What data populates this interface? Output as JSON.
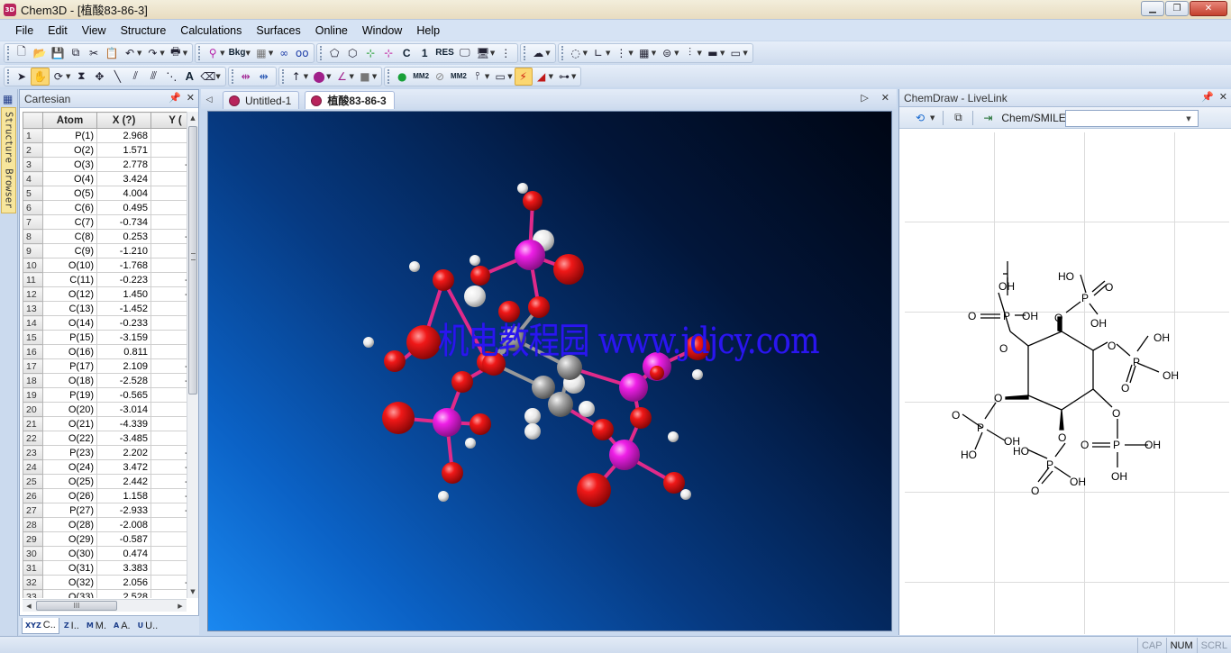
{
  "window": {
    "title": "Chem3D - [植酸83-86-3]",
    "app_icon": "3D"
  },
  "menu": [
    "File",
    "Edit",
    "View",
    "Structure",
    "Calculations",
    "Surfaces",
    "Online",
    "Window",
    "Help"
  ],
  "toolbar": {
    "bkg_label": "Bkg",
    "c_label": "C",
    "one_label": "1",
    "res_label": "RES",
    "mm2_label": "MM2",
    "mm2b_label": "MM2",
    "text_tool_label": "A"
  },
  "structure_browser": {
    "label": "Structure Browser"
  },
  "cartesian": {
    "title": "Cartesian",
    "columns": [
      "Atom",
      "X (?)",
      "Y ("
    ],
    "rows": [
      [
        "1",
        "P(1)",
        "2.968",
        "0."
      ],
      [
        "2",
        "O(2)",
        "1.571",
        "0."
      ],
      [
        "3",
        "O(3)",
        "2.778",
        "-1."
      ],
      [
        "4",
        "O(4)",
        "3.424",
        "0."
      ],
      [
        "5",
        "O(5)",
        "4.004",
        "0."
      ],
      [
        "6",
        "C(6)",
        "0.495",
        "0."
      ],
      [
        "7",
        "C(7)",
        "-0.734",
        "0."
      ],
      [
        "8",
        "C(8)",
        "0.253",
        "-0."
      ],
      [
        "9",
        "C(9)",
        "-1.210",
        "1."
      ],
      [
        "10",
        "O(10)",
        "-1.768",
        "0."
      ],
      [
        "11",
        "C(11)",
        "-0.223",
        "-0."
      ],
      [
        "12",
        "O(12)",
        "1.450",
        "-1."
      ],
      [
        "13",
        "C(13)",
        "-1.452",
        "0."
      ],
      [
        "14",
        "O(14)",
        "-0.233",
        "2."
      ],
      [
        "15",
        "P(15)",
        "-3.159",
        "1."
      ],
      [
        "16",
        "O(16)",
        "0.811",
        "0."
      ],
      [
        "17",
        "P(17)",
        "2.109",
        "-2."
      ],
      [
        "18",
        "O(18)",
        "-2.528",
        "-0."
      ],
      [
        "19",
        "P(19)",
        "-0.565",
        "3."
      ],
      [
        "20",
        "O(20)",
        "-3.014",
        "2."
      ],
      [
        "21",
        "O(21)",
        "-4.339",
        "0."
      ],
      [
        "22",
        "O(22)",
        "-3.485",
        "0."
      ],
      [
        "23",
        "P(23)",
        "2.202",
        "-0."
      ],
      [
        "24",
        "O(24)",
        "3.472",
        "-3."
      ],
      [
        "25",
        "O(25)",
        "2.442",
        "-1."
      ],
      [
        "26",
        "O(26)",
        "1.158",
        "-3."
      ],
      [
        "27",
        "P(27)",
        "-2.933",
        "-1."
      ],
      [
        "28",
        "O(28)",
        "-2.008",
        "2."
      ],
      [
        "29",
        "O(29)",
        "-0.587",
        "4."
      ],
      [
        "30",
        "O(30)",
        "0.474",
        "2."
      ],
      [
        "31",
        "O(31)",
        "3.383",
        "0."
      ],
      [
        "32",
        "O(32)",
        "2.056",
        "-1."
      ],
      [
        "33",
        "O(33)",
        "2.528",
        "0."
      ]
    ],
    "hscroll_grip": "III"
  },
  "bottom_tabs": [
    {
      "icon": "XYZ",
      "label": "C.."
    },
    {
      "icon": "Z",
      "label": "I.."
    },
    {
      "icon": "M",
      "label": "M."
    },
    {
      "icon": "A",
      "label": "A."
    },
    {
      "icon": "U",
      "label": "U.."
    }
  ],
  "documents": {
    "tabs": [
      "Untitled-1",
      "植酸83-86-3"
    ],
    "active": 1
  },
  "watermark": "机电教程园 www.jdjcy.com",
  "livelink": {
    "title": "ChemDraw - LiveLink",
    "smiles_label": "Chem/SMILES:",
    "smiles_value": ""
  },
  "status": [
    "CAP",
    "NUM",
    "SCRL"
  ],
  "status_on": "NUM",
  "colors": {
    "oxygen": "#f01818",
    "phosphorus": "#ee1fe6",
    "carbon": "#a8a8a8",
    "hydrogen": "#ffffff",
    "accent_tab": "#b8245c"
  }
}
